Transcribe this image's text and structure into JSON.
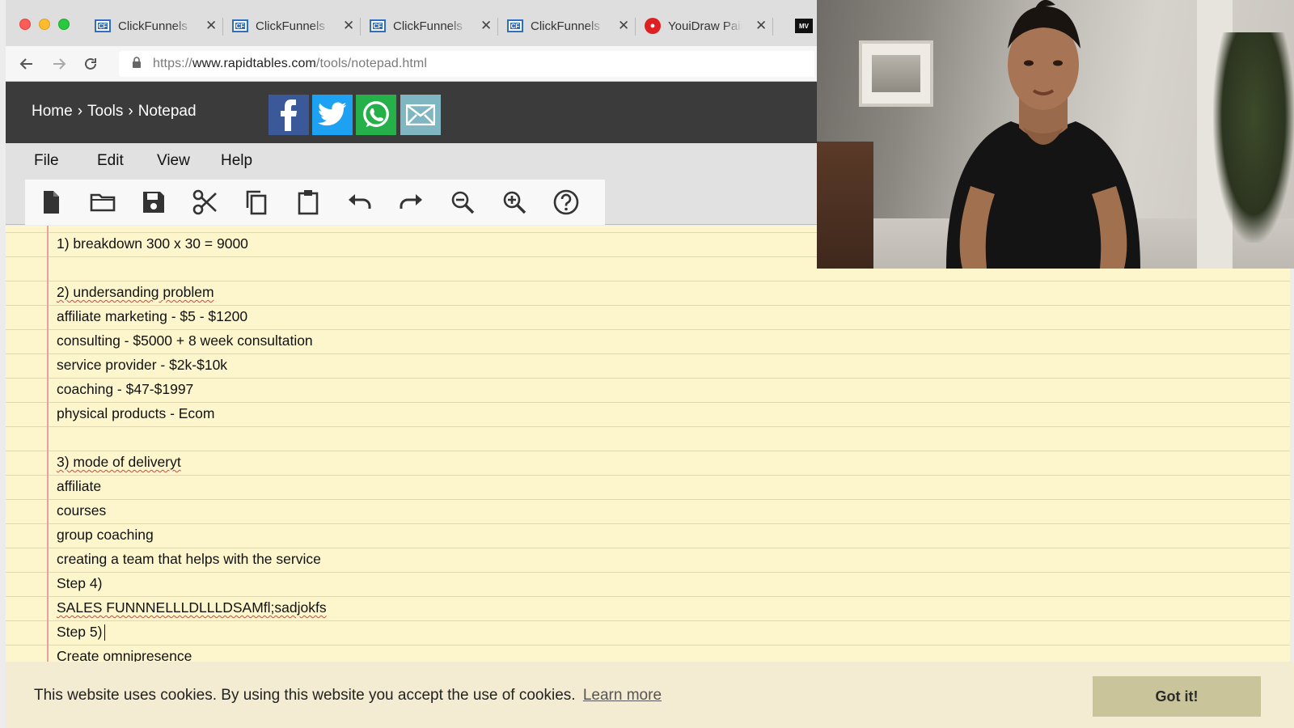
{
  "browser": {
    "tabs": [
      {
        "title": "ClickFunnels",
        "favicon": "clickfunnels-icon"
      },
      {
        "title": "ClickFunnels",
        "favicon": "clickfunnels-icon"
      },
      {
        "title": "ClickFunnels",
        "favicon": "clickfunnels-icon"
      },
      {
        "title": "ClickFunnels",
        "favicon": "clickfunnels-icon"
      },
      {
        "title": "YouiDraw Paint",
        "favicon": "youidraw-icon"
      }
    ],
    "extra_tab_badge": "MV",
    "url_scheme": "https://",
    "url_host": "www.rapidtables.com",
    "url_path": "/tools/notepad.html"
  },
  "site": {
    "breadcrumb": [
      "Home",
      "›",
      "Tools",
      "›",
      "Notepad"
    ],
    "share": [
      "facebook",
      "twitter",
      "whatsapp",
      "email"
    ]
  },
  "notepad": {
    "menu": [
      "File",
      "Edit",
      "View",
      "Help"
    ],
    "tools": [
      "new-file",
      "open-folder",
      "save",
      "cut",
      "copy",
      "paste",
      "undo",
      "redo",
      "zoom-out",
      "zoom-in",
      "help"
    ]
  },
  "text_lines": [
    "1) breakdown 300 x 30 = 9000",
    "",
    "2) undersanding problem",
    "affiliate marketing - $5 - $1200",
    "consulting - $5000 + 8 week consultation",
    "service provider - $2k-$10k",
    "coaching - $47-$1997",
    "physical products - Ecom",
    "",
    "3) mode of deliveryt",
    "affiliate",
    "courses",
    "group coaching",
    "creating a team that helps with the service",
    "Step 4)",
    "SALES FUNNNELLLDLLLDSAMfl;sadjokfs",
    "Step 5)",
    "Create omnipresence"
  ],
  "cookie": {
    "message": "This website uses cookies. By using this website you accept the use of cookies.",
    "learn_more": "Learn more",
    "button": "Got it!"
  },
  "colors": {
    "header_bg": "#3b3b3b",
    "paper_bg": "#fdf6cc",
    "cookie_bg": "#f3ecd2",
    "cookie_button": "#c9c49a"
  }
}
